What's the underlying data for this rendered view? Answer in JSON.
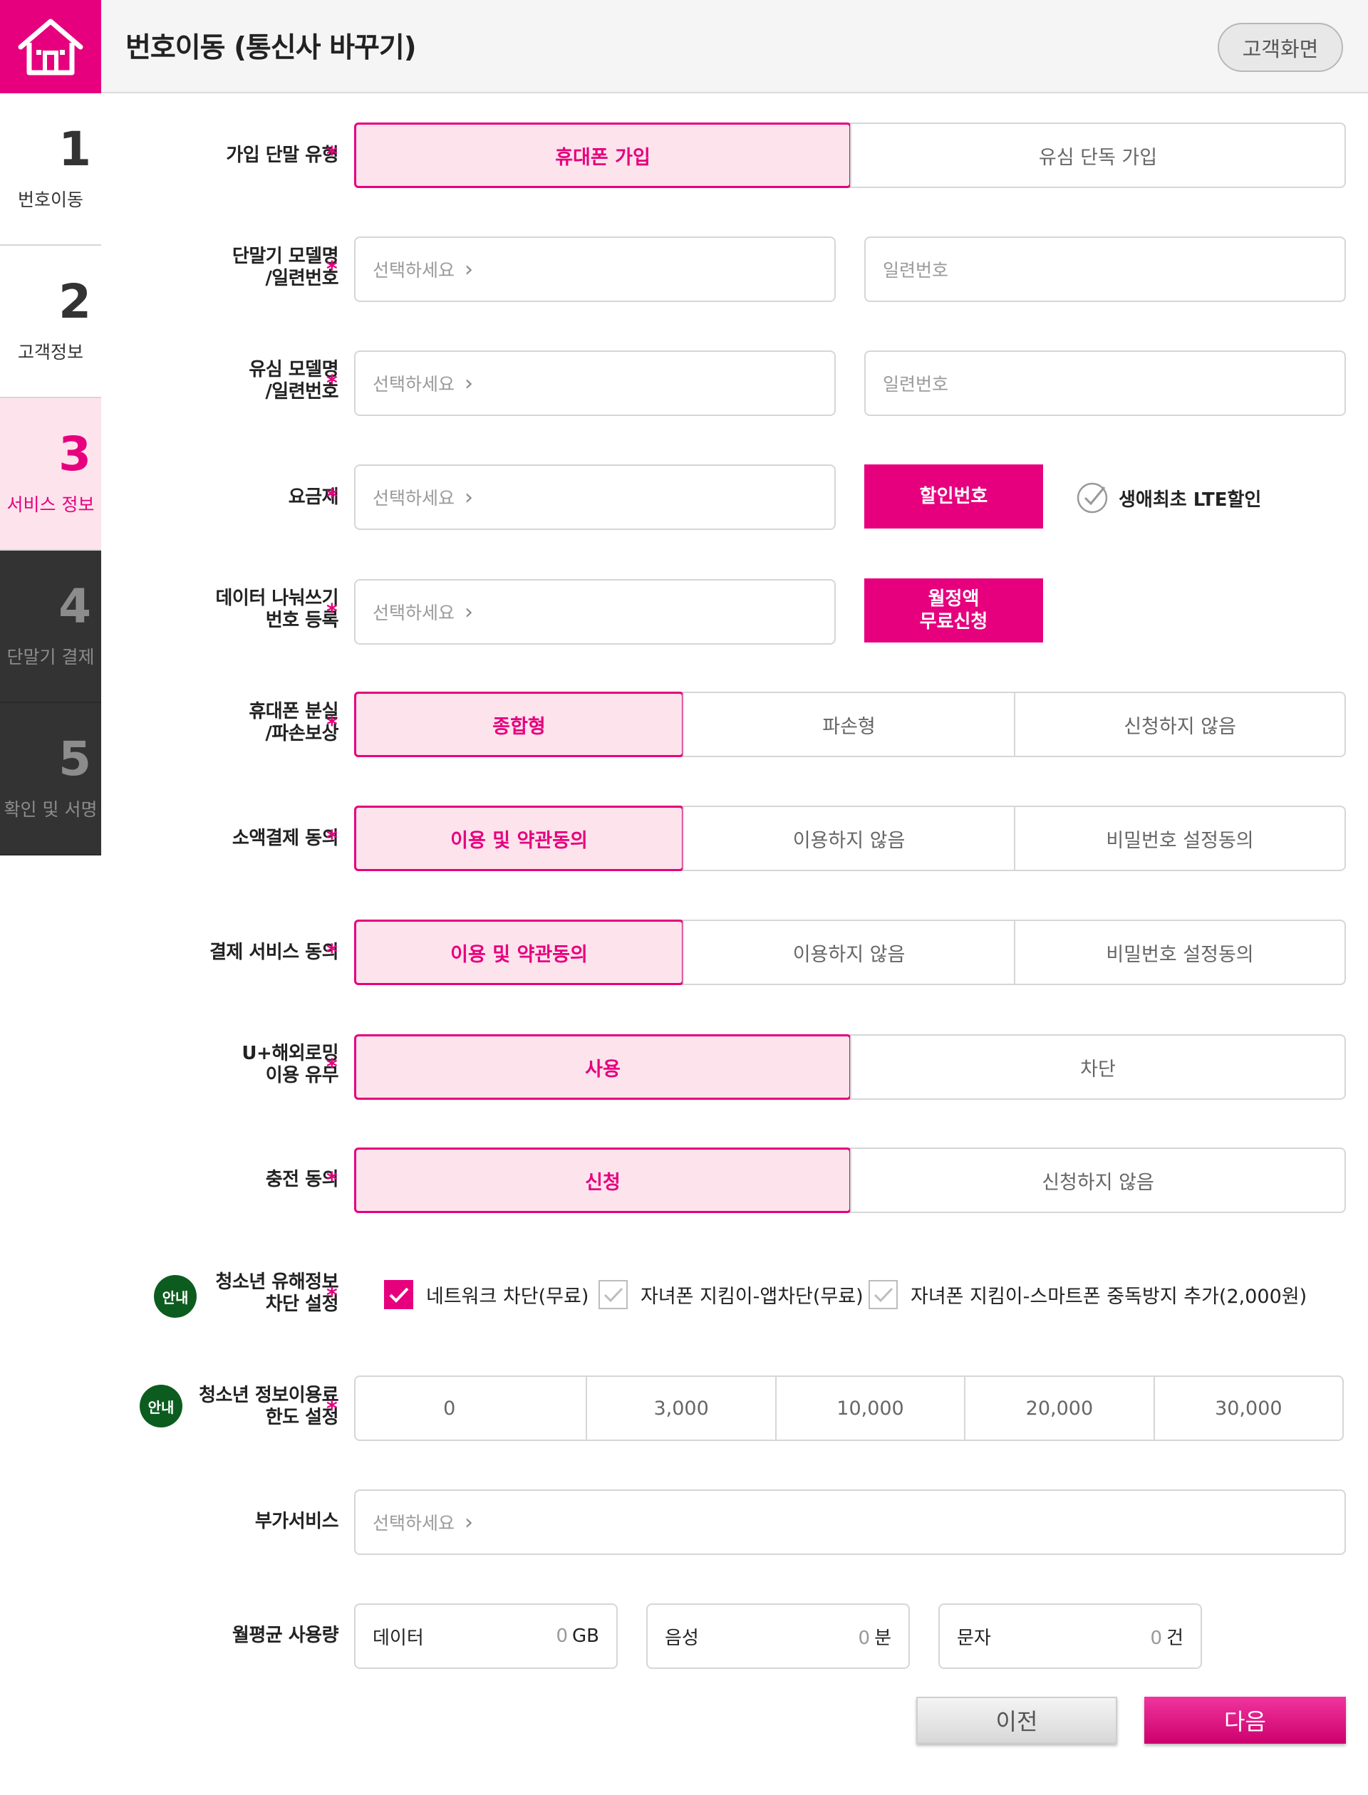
{
  "header": {
    "title": "번호이동 (통신사 바꾸기)",
    "customer_screen_button": "고객화면",
    "home_icon": "home-icon"
  },
  "steps": [
    {
      "number": "1",
      "label": "번호이동",
      "state": "done"
    },
    {
      "number": "2",
      "label": "고객정보",
      "state": "done"
    },
    {
      "number": "3",
      "label": "서비스 정보",
      "state": "active"
    },
    {
      "number": "4",
      "label": "단말기 결제",
      "state": "pending"
    },
    {
      "number": "5",
      "label": "확인 및 서명",
      "state": "pending"
    }
  ],
  "required_mark": "*",
  "colors": {
    "accent": "#e6007e",
    "accent_light": "#fde3ec",
    "guide_badge": "#0d5c1f",
    "step_dark": "#333333"
  },
  "form": {
    "join_type": {
      "label": "가입 단말 유형",
      "options": [
        "휴대폰 가입",
        "유심 단독 가입"
      ],
      "selected": "휴대폰 가입"
    },
    "device_model": {
      "label_line1": "단말기 모델명",
      "label_line2": "/일련번호",
      "select_placeholder": "선택하세요",
      "serial_placeholder": "일련번호"
    },
    "usim_model": {
      "label_line1": "유심 모델명",
      "label_line2": "/일련번호",
      "select_placeholder": "선택하세요",
      "serial_placeholder": "일련번호"
    },
    "plan": {
      "label": "요금제",
      "select_placeholder": "선택하세요",
      "discount_button": "할인번호",
      "first_lte_discount": "생애최초 LTE할인",
      "first_lte_checked": false
    },
    "data_share": {
      "label_line1": "데이터 나눠쓰기",
      "label_line2": "번호 등록",
      "select_placeholder": "선택하세요",
      "button_line1": "월정액",
      "button_line2": "무료신청"
    },
    "loss_damage": {
      "label_line1": "휴대폰 분실",
      "label_line2": "/파손보상",
      "options": [
        "종합형",
        "파손형",
        "신청하지 않음"
      ],
      "selected": "종합형"
    },
    "micropayment": {
      "label": "소액결제 동의",
      "options": [
        "이용 및 약관동의",
        "이용하지 않음",
        "비밀번호 설정동의"
      ],
      "selected": "이용 및 약관동의"
    },
    "payment_service": {
      "label": "결제 서비스 동의",
      "options": [
        "이용 및 약관동의",
        "이용하지 않음",
        "비밀번호 설정동의"
      ],
      "selected": "이용 및 약관동의"
    },
    "roaming": {
      "label_line1": "U+해외로밍",
      "label_line2": "이용 유무",
      "options": [
        "사용",
        "차단"
      ],
      "selected": "사용"
    },
    "charging": {
      "label": "충전 동의",
      "options": [
        "신청",
        "신청하지 않음"
      ],
      "selected": "신청"
    },
    "youth_harmful": {
      "guide_badge": "안내",
      "label_line1": "청소년 유해정보",
      "label_line2": "차단 설정",
      "checkboxes": [
        {
          "label": "네트워크 차단(무료)",
          "checked": true
        },
        {
          "label": "자녀폰 지킴이-앱차단(무료)",
          "checked": false
        },
        {
          "label": "자녀폰 지킴이-스마트폰 중독방지 추가(2,000원)",
          "checked": false
        }
      ]
    },
    "youth_limit": {
      "guide_badge": "안내",
      "label_line1": "청소년 정보이용료",
      "label_line2": "한도 설정",
      "options": [
        "0",
        "3,000",
        "10,000",
        "20,000",
        "30,000"
      ],
      "selected": null
    },
    "addon": {
      "label": "부가서비스",
      "select_placeholder": "선택하세요"
    },
    "monthly_usage": {
      "label": "월평균 사용량",
      "items": [
        {
          "name": "데이터",
          "value": "0",
          "unit": "GB"
        },
        {
          "name": "음성",
          "value": "0",
          "unit": "분"
        },
        {
          "name": "문자",
          "value": "0",
          "unit": "건"
        }
      ]
    }
  },
  "footer": {
    "prev_button": "이전",
    "next_button": "다음"
  }
}
